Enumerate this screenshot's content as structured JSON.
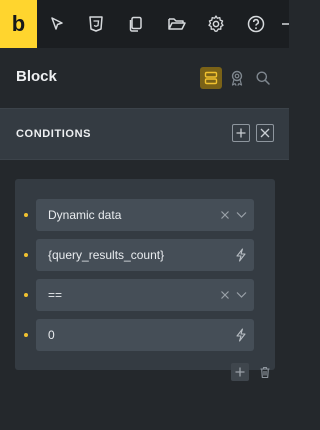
{
  "toolbar": {
    "logo_letter": "b",
    "icons": [
      "cursor-icon",
      "css3-icon",
      "pages-icon",
      "folder-icon",
      "gear-icon",
      "help-icon"
    ]
  },
  "header": {
    "title": "Block",
    "icons": [
      "conditions-icon",
      "badge-icon",
      "search-icon"
    ]
  },
  "conditions": {
    "title": "CONDITIONS",
    "rows": [
      {
        "value": "Dynamic data",
        "control": "select"
      },
      {
        "value": "{query_results_count}",
        "control": "dynamic"
      },
      {
        "value": "==",
        "control": "select"
      },
      {
        "value": "0",
        "control": "dynamic"
      }
    ]
  },
  "colors": {
    "accent": "#ffd52e",
    "panel": "#343b42",
    "field": "#454e57",
    "background": "#24282c"
  }
}
